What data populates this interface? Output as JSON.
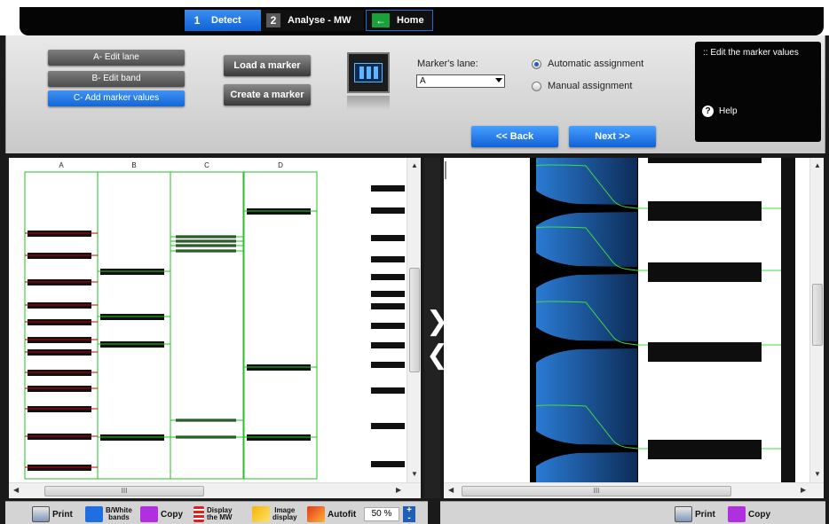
{
  "tabs": [
    {
      "num": "1",
      "label": "Detect"
    },
    {
      "num": "2",
      "label": "Analyse - MW"
    },
    {
      "num": "",
      "label": "Home"
    }
  ],
  "lane_buttons": [
    "A- Edit lane",
    "B- Edit band",
    "C- Add marker values"
  ],
  "marker_buttons": {
    "load": "Load a marker",
    "create": "Create a marker"
  },
  "marker_lane": {
    "label": "Marker's lane:",
    "value": "A"
  },
  "assignment": {
    "automatic": "Automatic assignment",
    "manual": "Manual assignment",
    "selected": "automatic"
  },
  "nav": {
    "back": "<< Back",
    "next": "Next >>"
  },
  "info": {
    "text": ":: Edit the marker values",
    "help": "Help"
  },
  "gel": {
    "lanes": [
      "A",
      "B",
      "C",
      "D"
    ],
    "marker_bands": [
      263,
      288,
      318,
      344,
      363,
      383,
      397,
      420,
      438,
      461,
      492,
      527
    ],
    "lane_b_bands": [
      306,
      357,
      388,
      493
    ],
    "lane_c_bands": [
      267,
      272,
      277,
      283,
      474,
      493
    ],
    "lane_d_bands": [
      238,
      414,
      493
    ],
    "ladder_bands": [
      212,
      237,
      268,
      292,
      312,
      331,
      345,
      367,
      389,
      411,
      440,
      480,
      523
    ]
  },
  "bottom_left_tools": {
    "print": "Print",
    "bw": [
      "B/White",
      "bands"
    ],
    "copy": "Copy",
    "display_mw": [
      "Display",
      "the MW"
    ],
    "image_display": [
      "Image",
      "display"
    ],
    "autofit": "Autofit",
    "zoom": "50 %"
  },
  "bottom_right_tools": {
    "print": "Print",
    "copy": "Copy"
  },
  "colors": {
    "accent": "#1466d8",
    "lane_line": "#22c322",
    "marker_line": "#c00000"
  },
  "scroll_glyph": "III"
}
